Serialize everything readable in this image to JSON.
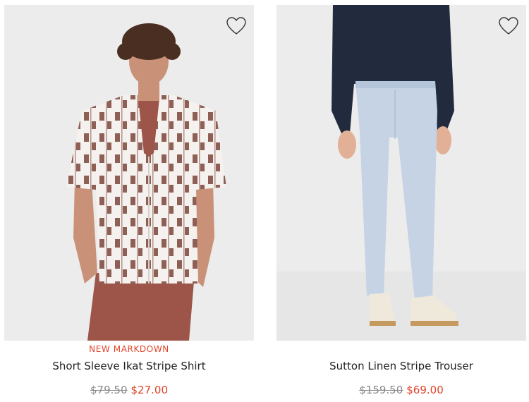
{
  "products": [
    {
      "badge": "NEW MARKDOWN",
      "name": "Short Sleeve Ikat Stripe Shirt",
      "original_price": "$79.50",
      "sale_price": "$27.00",
      "favorite_icon": "heart-outline-icon"
    },
    {
      "badge": "",
      "name": "Sutton Linen Stripe Trouser",
      "original_price": "$159.50",
      "sale_price": "$69.00",
      "favorite_icon": "heart-outline-icon"
    }
  ],
  "colors": {
    "sale": "#e0432a",
    "strikethrough": "#8b8b8b",
    "text": "#222222",
    "image_background": "#ececec"
  }
}
